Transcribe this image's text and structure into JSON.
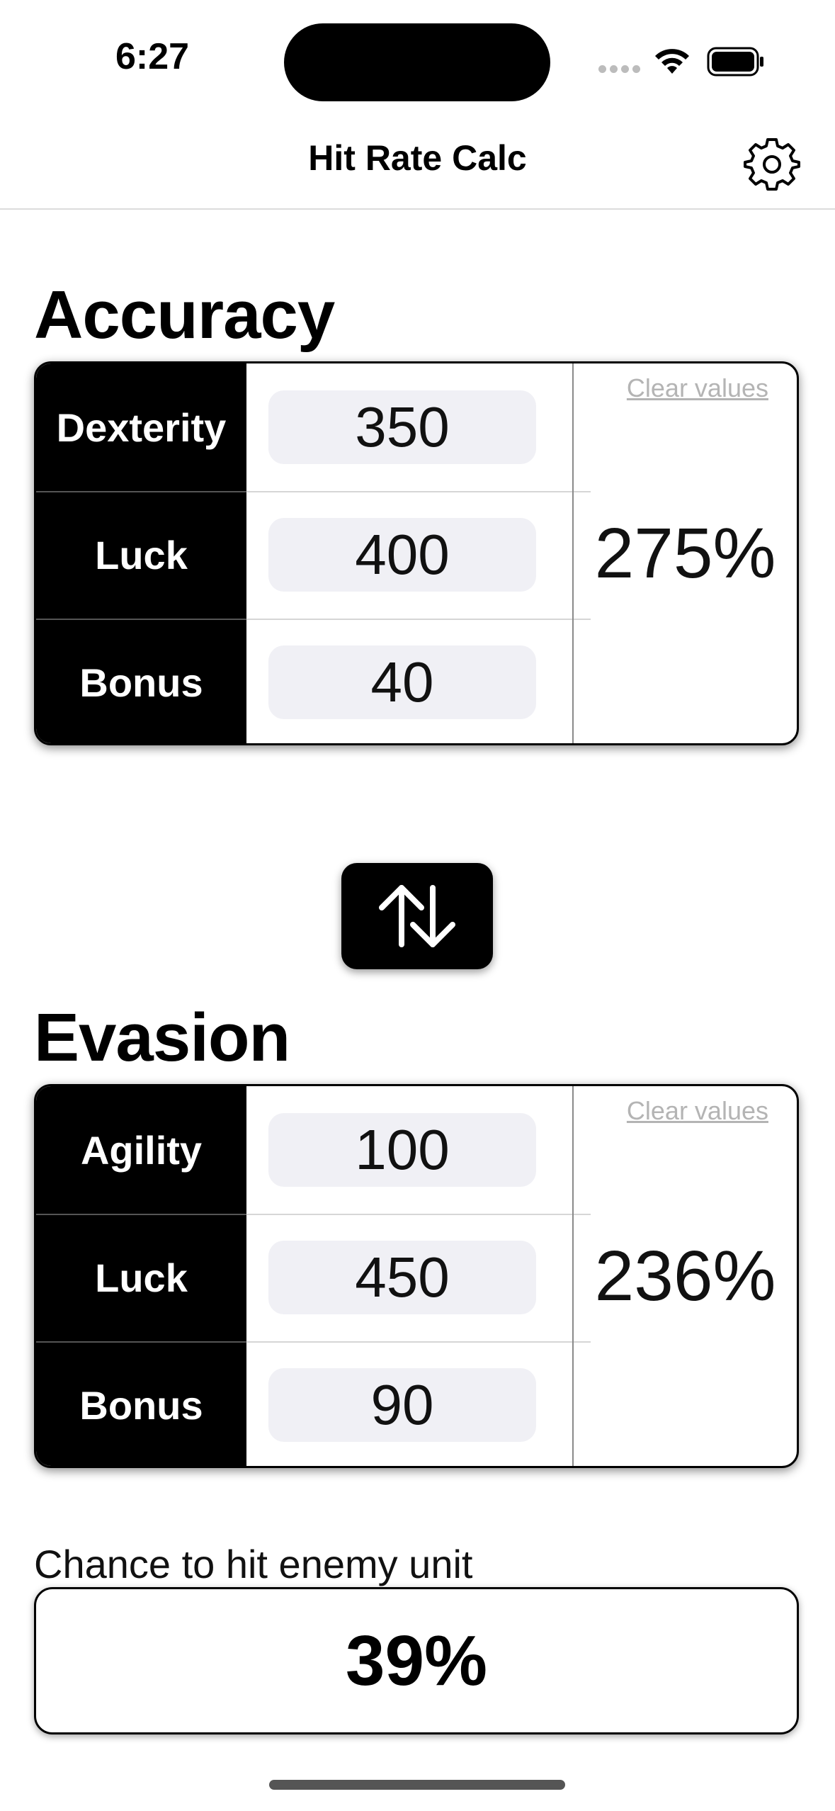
{
  "status_bar": {
    "time": "6:27"
  },
  "nav": {
    "title": "Hit Rate Calc",
    "settings_icon": "gear-icon"
  },
  "accuracy": {
    "title": "Accuracy",
    "rows": [
      {
        "label": "Dexterity",
        "value": "350"
      },
      {
        "label": "Luck",
        "value": "400"
      },
      {
        "label": "Bonus",
        "value": "40"
      }
    ],
    "clear_label": "Clear values",
    "result": "275%"
  },
  "swap": {
    "icon": "swap-arrows-icon"
  },
  "evasion": {
    "title": "Evasion",
    "rows": [
      {
        "label": "Agility",
        "value": "100"
      },
      {
        "label": "Luck",
        "value": "450"
      },
      {
        "label": "Bonus",
        "value": "90"
      }
    ],
    "clear_label": "Clear values",
    "result": "236%"
  },
  "chance": {
    "label": "Chance to hit enemy unit",
    "value": "39%"
  }
}
